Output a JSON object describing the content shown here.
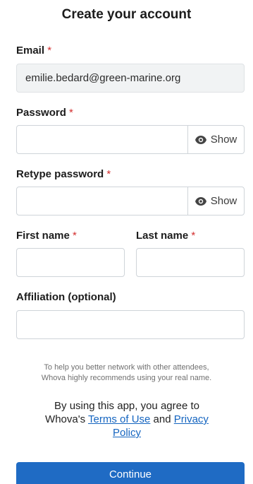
{
  "header": {
    "title": "Create your account"
  },
  "form": {
    "email": {
      "label": "Email",
      "required_mark": "*",
      "value": "emilie.bedard@green-marine.org"
    },
    "password": {
      "label": "Password",
      "required_mark": "*",
      "value": "",
      "show_label": "Show"
    },
    "retype_password": {
      "label": "Retype password",
      "required_mark": "*",
      "value": "",
      "show_label": "Show"
    },
    "first_name": {
      "label": "First name",
      "required_mark": "*",
      "value": ""
    },
    "last_name": {
      "label": "Last name",
      "required_mark": "*",
      "value": ""
    },
    "affiliation": {
      "label": "Affiliation (optional)",
      "value": ""
    }
  },
  "help_text": {
    "line1": "To help you better network with other attendees,",
    "line2": "Whova highly recommends using your real name."
  },
  "legal": {
    "prefix": "By using this app, you agree to Whova's",
    "terms_link": "Terms of Use",
    "conjunction": "and",
    "privacy_link": "Privacy Policy"
  },
  "actions": {
    "continue_label": "Continue"
  },
  "colors": {
    "primary": "#1f6bc4",
    "required": "#d32f2f",
    "link": "#1565c0"
  },
  "icons": {
    "show_password": "eye-icon"
  }
}
